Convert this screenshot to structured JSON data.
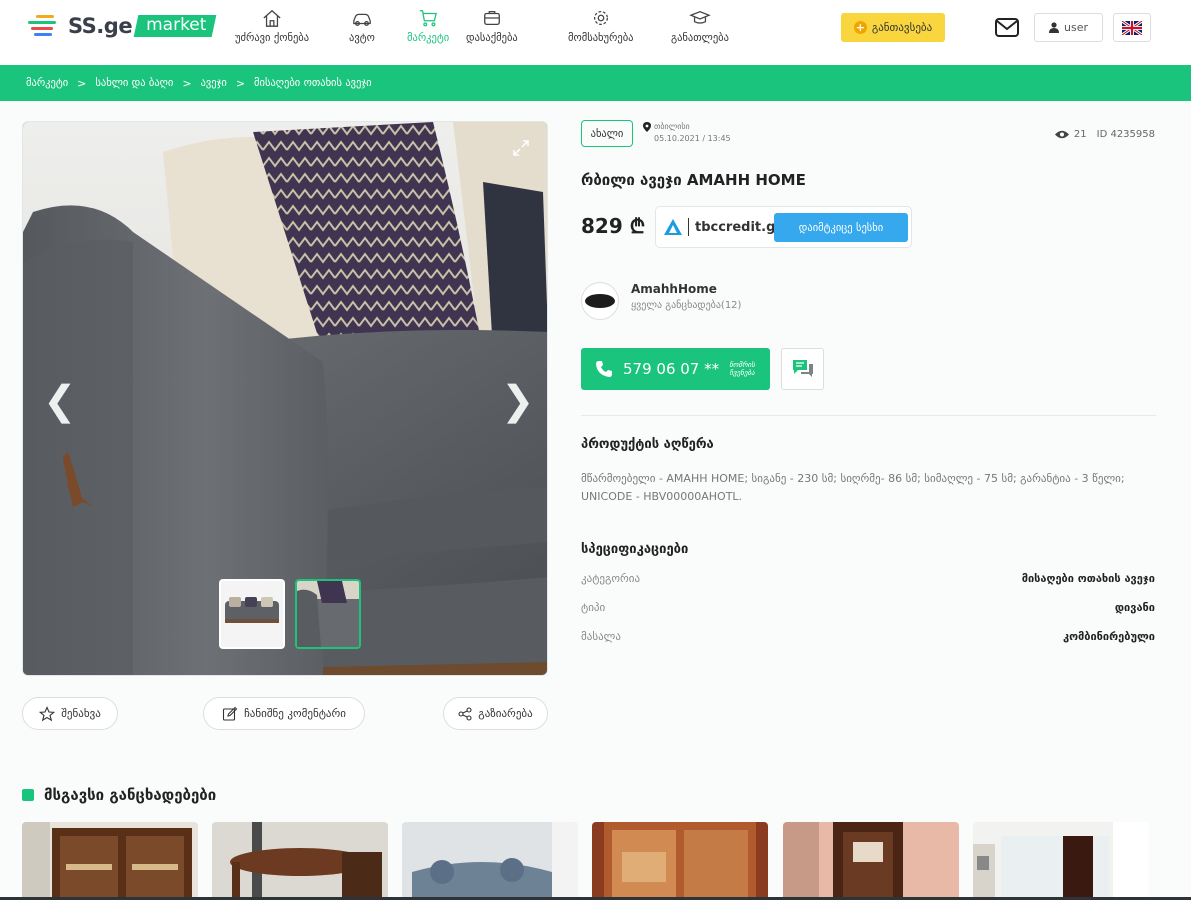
{
  "header": {
    "logo_text": "SS.ge",
    "logo_badge": "market",
    "nav": [
      {
        "label": "უძრავი ქონება",
        "icon": "house-icon"
      },
      {
        "label": "ავტო",
        "icon": "car-icon"
      },
      {
        "label": "მარკეტი",
        "icon": "cart-icon",
        "active": true
      },
      {
        "label": "დასაქმება",
        "icon": "briefcase-icon"
      },
      {
        "label": "მომსახურება",
        "icon": "gear-icon"
      },
      {
        "label": "განათლება",
        "icon": "graduation-cap-icon"
      }
    ],
    "post_button": "განთავსება",
    "user_button": "user",
    "language_flag": "flag-gb-icon"
  },
  "breadcrumb": [
    "მარკეტი",
    "სახლი და ბაღი",
    "ავეჯი",
    "მისაღები ოთახის ავეჯი"
  ],
  "gallery": {
    "thumbnails": 2,
    "active_index": 1
  },
  "actions": {
    "save": "შენახვა",
    "comment": "ჩანიშნე კომენტარი",
    "share": "გაზიარება"
  },
  "listing": {
    "condition_badge": "ახალი",
    "location": "თბილისი",
    "date": "05.10.2021 / 13:45",
    "views": "21",
    "id": "ID 4235958",
    "title": "რბილი ავეჯი AMAHH HOME",
    "price": "829 ₾",
    "credit_brand": "tbccredit.ge",
    "credit_button": "დაიმტკიცე სესხი"
  },
  "seller": {
    "name": "AmahhHome",
    "all_listings": "ყველა განცხადება(12)"
  },
  "contact": {
    "phone": "579 06 07 **",
    "show_number": "ნომრის ჩვენება"
  },
  "description": {
    "title": "პროდუქტის აღწერა",
    "text": "მწარმოებელი - AMAHH HOME; სიგანე - 230 სმ; სიღრმე- 86 სმ; სიმაღლე - 75 სმ; გარანტია - 3 წელი; UNICODE - HBV00000AHOTL."
  },
  "specs": {
    "title": "სპეციფიკაციები",
    "rows": [
      {
        "label": "კატეგორია",
        "value": "მისაღები ოთახის ავეჯი"
      },
      {
        "label": "ტიპი",
        "value": "დივანი"
      },
      {
        "label": "მასალა",
        "value": "კომბინირებული"
      }
    ]
  },
  "similar": {
    "title": "მსგავსი განცხადებები",
    "cards": 6
  },
  "colors": {
    "brand_green": "#1bc47d",
    "post_yellow": "#f9d53e",
    "credit_blue": "#35a8ee"
  }
}
